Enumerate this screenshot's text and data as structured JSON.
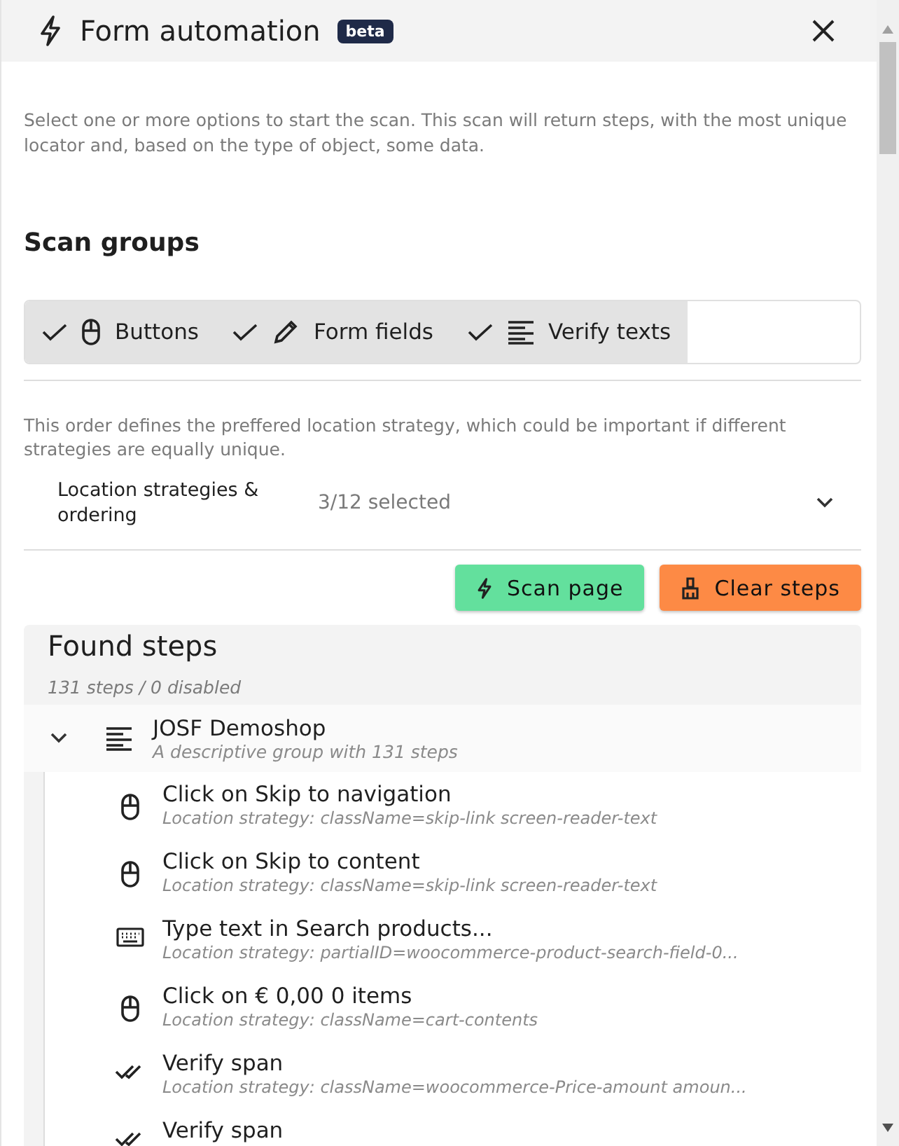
{
  "header": {
    "title": "Form automation",
    "badge": "beta"
  },
  "description": "Select one or more options to start the scan. This scan will return steps, with the most unique locator and, based on the type of object, some data.",
  "scan_groups": {
    "title": "Scan groups",
    "items": [
      {
        "label": "Buttons",
        "kind": "mouse",
        "checked": true
      },
      {
        "label": "Form fields",
        "kind": "pencil",
        "checked": true
      },
      {
        "label": "Verify texts",
        "kind": "lines",
        "checked": true
      }
    ]
  },
  "strategy_note": "This order defines the preffered location strategy, which could be important if different strategies are equally unique.",
  "strategy_select": {
    "label": "Location strategies & ordering",
    "value": "3/12 selected"
  },
  "buttons": [
    {
      "label": "Scan page",
      "kind": "scan"
    },
    {
      "label": "Clear steps",
      "kind": "clear"
    }
  ],
  "found_steps": {
    "title": "Found steps",
    "summary": "131 steps / 0 disabled",
    "group": {
      "title": "JOSF Demoshop",
      "subtitle": "A descriptive group with 131 steps",
      "expanded": true
    },
    "steps": [
      {
        "kind": "click",
        "title": "Click on Skip to navigation",
        "subtitle": "Location strategy: className=skip-link screen-reader-text"
      },
      {
        "kind": "click",
        "title": "Click on Skip to content",
        "subtitle": "Location strategy: className=skip-link screen-reader-text"
      },
      {
        "kind": "type",
        "title": "Type text in Search products...",
        "subtitle": "Location strategy: partialID=woocommerce-product-search-field-0..."
      },
      {
        "kind": "click",
        "title": "Click on € 0,00 0 items",
        "subtitle": "Location strategy: className=cart-contents"
      },
      {
        "kind": "verify",
        "title": "Verify span",
        "subtitle": "Location strategy: className=woocommerce-Price-amount amoun..."
      },
      {
        "kind": "verify",
        "title": "Verify span"
      }
    ]
  }
}
